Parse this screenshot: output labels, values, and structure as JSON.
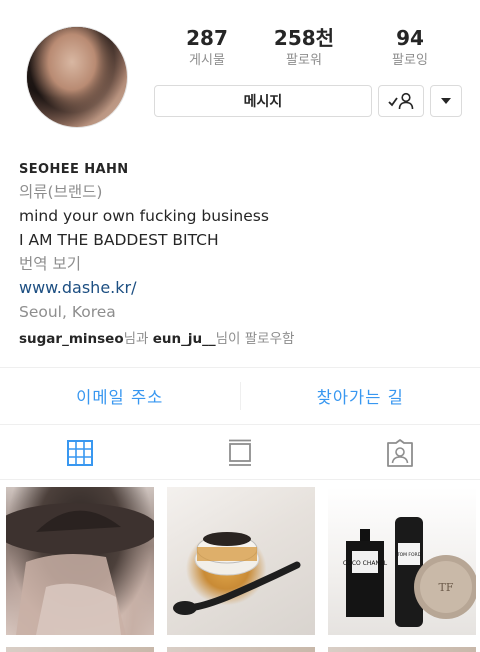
{
  "profile": {
    "stats": [
      {
        "value": "287",
        "label": "게시물"
      },
      {
        "value": "258천",
        "label": "팔로워"
      },
      {
        "value": "94",
        "label": "팔로잉"
      }
    ],
    "message_button": "메시지"
  },
  "bio": {
    "name": "SEOHEE HAHN",
    "category": "의류(브랜드)",
    "line1": "mind your own fucking business",
    "line2": "I AM THE BADDEST BITCH",
    "translate": "번역 보기",
    "website": "www.dashe.kr/",
    "location": "Seoul, Korea",
    "followed_user1": "sugar_minseo",
    "followed_join": "님과 ",
    "followed_user2": "eun_ju__",
    "followed_suffix": "님이 팔로우함"
  },
  "contact": {
    "email": "이메일 주소",
    "directions": "찾아가는 길"
  },
  "thumb3": {
    "bottle_label": "COCO CHANEL",
    "spray_label": "TOM FORD",
    "compact_label": "TF"
  },
  "colors": {
    "accent": "#3897f0",
    "link": "#1d4f82",
    "muted": "#8e8e8e"
  }
}
